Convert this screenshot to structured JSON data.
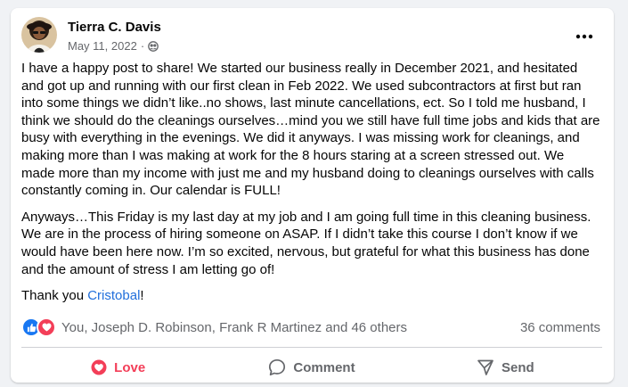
{
  "post": {
    "author": "Tierra C. Davis",
    "date": "May 11, 2022",
    "separator": "·",
    "paragraphs": [
      "I have a happy post to share! We started our business really in December 2021, and hesitated and got up and running with our first clean in Feb 2022. We used subcontractors at first but ran into some things we didn’t like..no shows, last minute cancellations, ect. So I told me husband, I think we should do the cleanings ourselves…mind you we still have full time jobs and kids that are busy with everything in the evenings. We did it anyways. I was missing work for cleanings, and making more than I was making at work for the 8 hours staring at a screen stressed out. We made more than my income with just me and my husband doing to cleanings ourselves with calls constantly coming in. Our calendar is FULL!",
      "Anyways…This Friday is my last day at my job and I am going full time in this cleaning business. We are in the process of hiring someone on ASAP. If I didn’t take this course I don’t know if we would have been here now. I’m so excited, nervous, but grateful for what this business has done and the amount of stress I am letting go of!"
    ],
    "thanks_prefix": "Thank you ",
    "mention": "Cristobal",
    "thanks_suffix": "!"
  },
  "reactions": {
    "summary": "You, Joseph D. Robinson, Frank R Martinez and 46 others",
    "comments": "36 comments",
    "icons": [
      "like-icon",
      "love-icon"
    ]
  },
  "actions": {
    "love": "Love",
    "comment": "Comment",
    "send": "Send"
  },
  "colors": {
    "like": "#1877f2",
    "love": "#f33e58",
    "mention": "#216fdb",
    "secondary_text": "#65676b"
  }
}
